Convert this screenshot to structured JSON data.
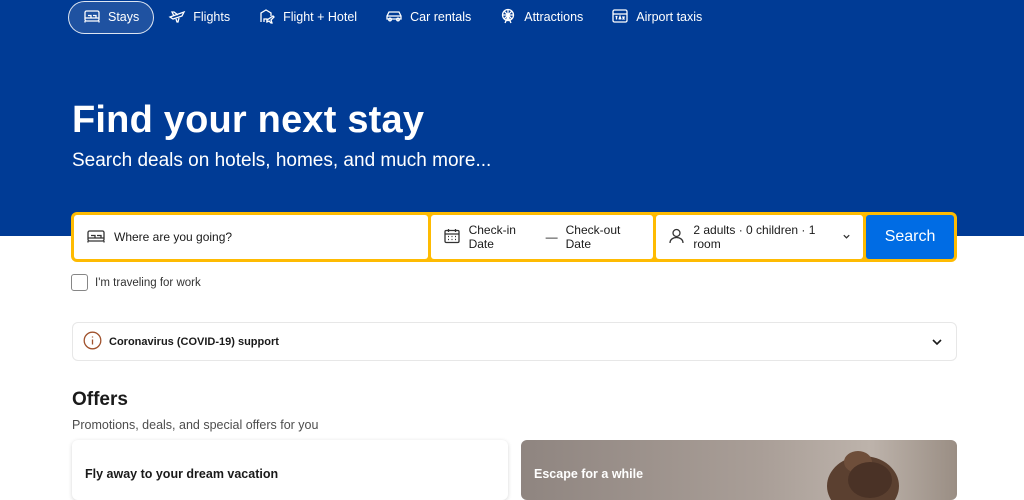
{
  "nav": {
    "items": [
      {
        "label": "Stays",
        "icon": "bed-icon",
        "active": true
      },
      {
        "label": "Flights",
        "icon": "plane-icon",
        "active": false
      },
      {
        "label": "Flight + Hotel",
        "icon": "flight-hotel-icon",
        "active": false
      },
      {
        "label": "Car rentals",
        "icon": "car-icon",
        "active": false
      },
      {
        "label": "Attractions",
        "icon": "ferris-wheel-icon",
        "active": false
      },
      {
        "label": "Airport taxis",
        "icon": "taxi-icon",
        "active": false
      }
    ]
  },
  "hero": {
    "title": "Find your next stay",
    "subtitle": "Search deals on hotels, homes, and much more..."
  },
  "search": {
    "destination_placeholder": "Where are you going?",
    "checkin_label": "Check-in Date",
    "date_separator": "—",
    "checkout_label": "Check-out Date",
    "guests_label": "2 adults · 0 children · 1 room",
    "search_label": "Search"
  },
  "work_travel": {
    "label": "I'm traveling for work",
    "checked": false
  },
  "covid": {
    "label": "Coronavirus (COVID-19) support"
  },
  "offers": {
    "title": "Offers",
    "subtitle": "Promotions, deals, and special offers for you",
    "cards": [
      {
        "title": "Fly away to your dream vacation"
      },
      {
        "title": "Escape for a while"
      }
    ]
  },
  "colors": {
    "brand_blue": "#003b95",
    "accent_yellow": "#febb02",
    "button_blue": "#006ce4",
    "info_brown": "#a0522d"
  }
}
